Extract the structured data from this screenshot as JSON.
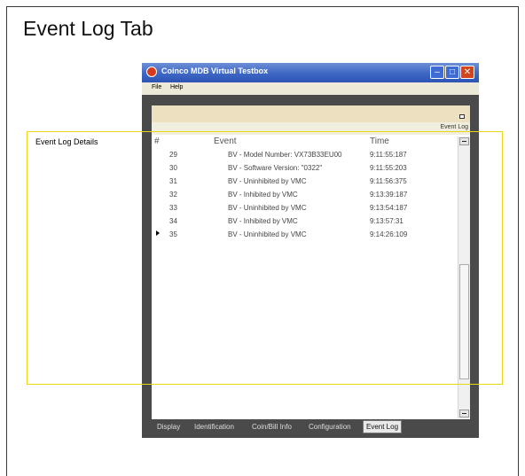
{
  "slide": {
    "title": "Event Log Tab"
  },
  "window": {
    "title": "Coinco MDB Virtual Testbox",
    "menu": [
      "File",
      "Help"
    ],
    "caption": "Event Log"
  },
  "table": {
    "columns": [
      "#",
      "Event",
      "Time"
    ],
    "rows": [
      {
        "num": "29",
        "event": "BV - Model Number: VX73B33EU00",
        "time": "9:11:55:187"
      },
      {
        "num": "30",
        "event": "BV - Software Version: \"0322\"",
        "time": "9:11:55:203"
      },
      {
        "num": "31",
        "event": "BV - Uninhibited by VMC",
        "time": "9:11:56:375"
      },
      {
        "num": "32",
        "event": "BV - Inhibited by VMC",
        "time": "9:13:39:187"
      },
      {
        "num": "33",
        "event": "BV - Uninhibited by VMC",
        "time": "9:13:54:187"
      },
      {
        "num": "34",
        "event": "BV - Inhibited by VMC",
        "time": "9:13:57:31"
      },
      {
        "num": "35",
        "event": "BV - Uninhibited by VMC",
        "time": "9:14:26:109"
      }
    ]
  },
  "tabs": [
    "Display",
    "Identification",
    "Coin/Bill Info",
    "Configuration",
    "Event Log"
  ],
  "callout": {
    "label": "Event Log Details"
  },
  "colors": {
    "titlebar": "#3e66c4",
    "callout": "#e8d813",
    "window_frame": "#4a4a4a"
  }
}
